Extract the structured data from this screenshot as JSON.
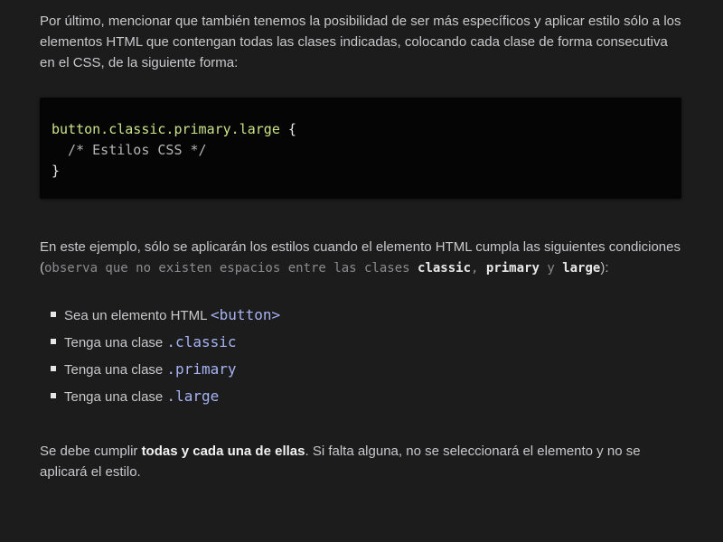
{
  "intro": {
    "text": "Por último, mencionar que también tenemos la posibilidad de ser más específicos y aplicar estilo sólo a los elementos HTML que contengan todas las clases indicadas, colocando cada clase de forma consecutiva en el CSS, de la siguiente forma:"
  },
  "code_block": {
    "selector": "button.classic.primary.large",
    "open_brace": " {",
    "comment": "  /* Estilos CSS */",
    "close_brace": "}"
  },
  "conditions": {
    "text_before": "En este ejemplo, sólo se aplicarán los estilos cuando el elemento HTML cumpla las siguientes condiciones",
    "paren_open": "(",
    "note": "observa que no existen espacios entre las clases ",
    "class1": "classic",
    "sep1": ", ",
    "class2": "primary",
    "sep2": " y ",
    "class3": "large",
    "paren_close": "):"
  },
  "list": {
    "items": [
      {
        "prefix": "Sea un elemento HTML ",
        "code": "<button>"
      },
      {
        "prefix": "Tenga una clase ",
        "code": ".classic"
      },
      {
        "prefix": "Tenga una clase ",
        "code": ".primary"
      },
      {
        "prefix": "Tenga una clase ",
        "code": ".large"
      }
    ]
  },
  "outro": {
    "before": "Se debe cumplir ",
    "bold": "todas y cada una de ellas",
    "after": ". Si falta alguna, no se seleccionará el elemento y no se aplicará el estilo."
  },
  "colors": {
    "background": "#1c1c1d",
    "code_background": "#050505",
    "selector": "#cde386",
    "code_accent": "#a6b3f2"
  }
}
